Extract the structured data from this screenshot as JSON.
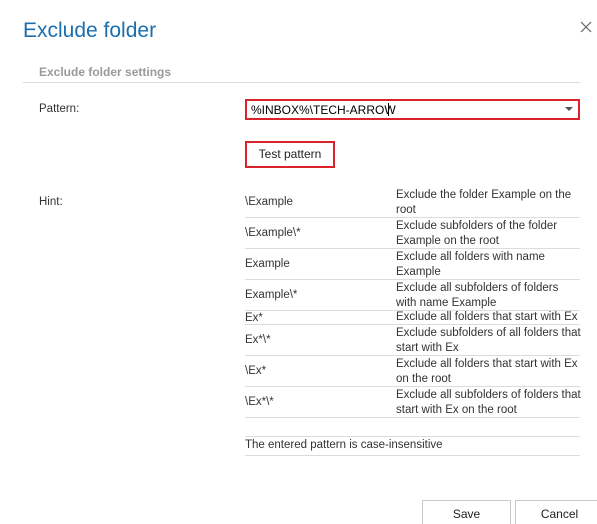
{
  "dialog": {
    "title": "Exclude folder",
    "close_icon": "close-icon"
  },
  "section": {
    "title": "Exclude folder settings"
  },
  "pattern": {
    "label": "Pattern:",
    "value": "%INBOX%\\TECH-ARROW"
  },
  "test_button": {
    "label": "Test pattern"
  },
  "hint": {
    "label": "Hint:",
    "rows": [
      {
        "pattern": "\\Example",
        "description": "Exclude the folder Example on the root"
      },
      {
        "pattern": "\\Example\\*",
        "description": "Exclude subfolders of the folder Example on the root"
      },
      {
        "pattern": "Example",
        "description": "Exclude all folders with name Example"
      },
      {
        "pattern": "Example\\*",
        "description": "Exclude all subfolders of folders with name Example"
      },
      {
        "pattern": "Ex*",
        "description": "Exclude all folders that start with Ex"
      },
      {
        "pattern": "Ex*\\*",
        "description": "Exclude subfolders of all folders that start with Ex"
      },
      {
        "pattern": "\\Ex*",
        "description": "Exclude all folders that start with Ex on the root"
      },
      {
        "pattern": "\\Ex*\\*",
        "description": "Exclude all subfolders of folders that start with Ex on the root"
      }
    ],
    "note": "The entered pattern is case-insensitive"
  },
  "footer": {
    "save_label": "Save",
    "cancel_label": "Cancel"
  },
  "colors": {
    "title": "#1c6fae",
    "highlight_border": "#d9242b",
    "section_title": "#9a9a9a"
  }
}
